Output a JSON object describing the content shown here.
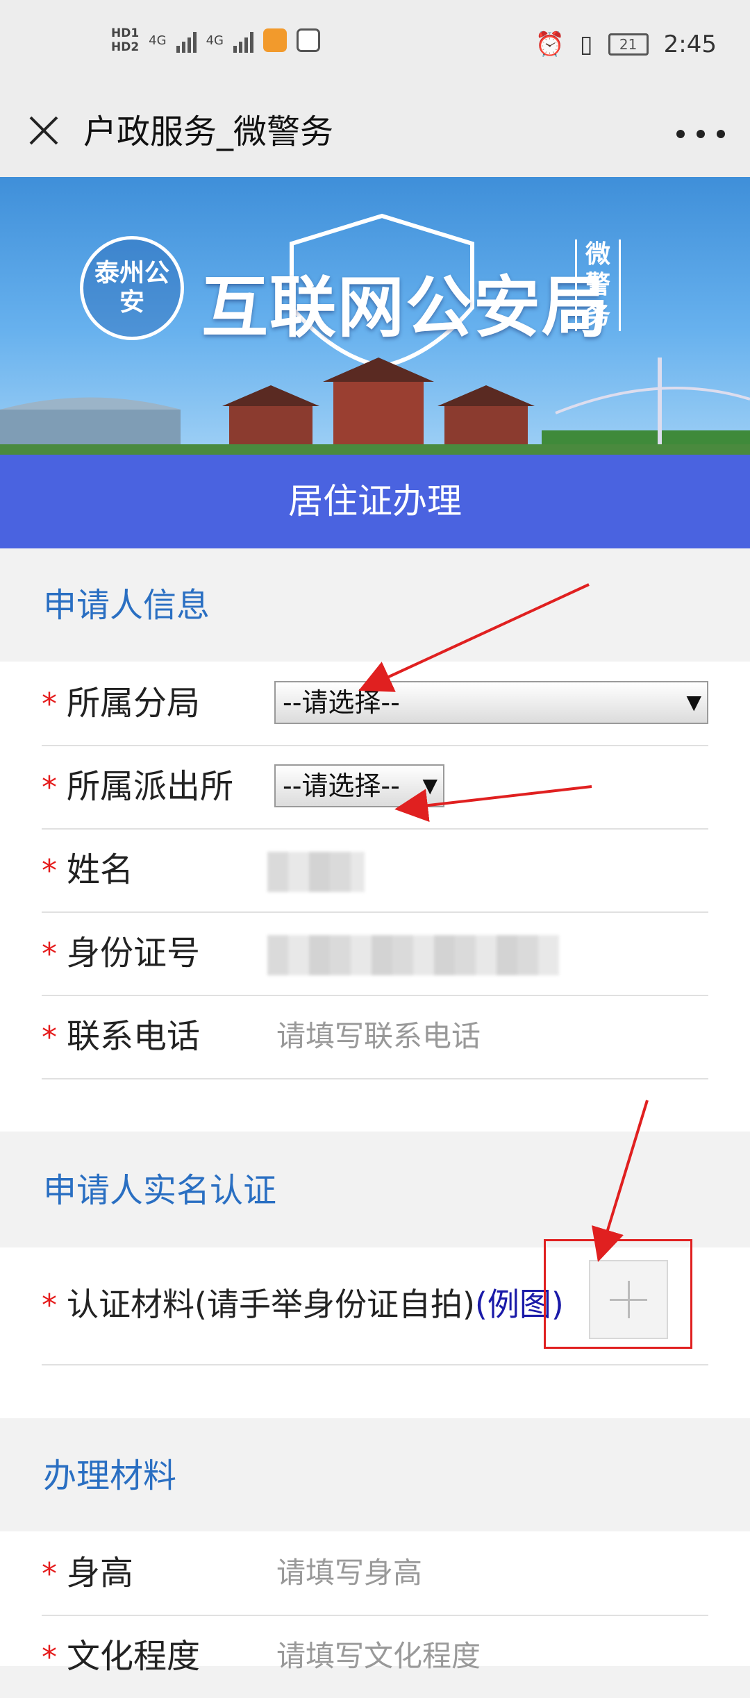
{
  "status_bar": {
    "network": [
      "HD1",
      "HD2"
    ],
    "signal_1": "4G",
    "signal_2": "4G",
    "battery": "21",
    "time": "2:45"
  },
  "titlebar": {
    "title": "户政服务_微警务"
  },
  "banner": {
    "badge_text": "泰州公安",
    "title": "互联网公安局",
    "tag": "微警务"
  },
  "form_header": "居住证办理",
  "sections": {
    "applicant_info": "申请人信息",
    "realname_auth": "申请人实名认证",
    "materials": "办理材料"
  },
  "fields": {
    "branch": {
      "label": "所属分局",
      "value": "--请选择--"
    },
    "station": {
      "label": "所属派出所",
      "value": "--请选择--"
    },
    "name": {
      "label": "姓名"
    },
    "id_number": {
      "label": "身份证号"
    },
    "phone": {
      "label": "联系电话",
      "placeholder": "请填写联系电话"
    },
    "auth_material": {
      "label": "认证材料(请手举身份证自拍)",
      "example": "(例图)"
    },
    "height": {
      "label": "身高",
      "placeholder": "请填写身高"
    },
    "education": {
      "label": "文化程度",
      "placeholder": "请填写文化程度"
    }
  },
  "required_mark": "*",
  "colors": {
    "accent_blue": "#4a63e0",
    "section_title": "#2a6fc2",
    "required": "#e51c1c",
    "annotation_red": "#e02020"
  }
}
